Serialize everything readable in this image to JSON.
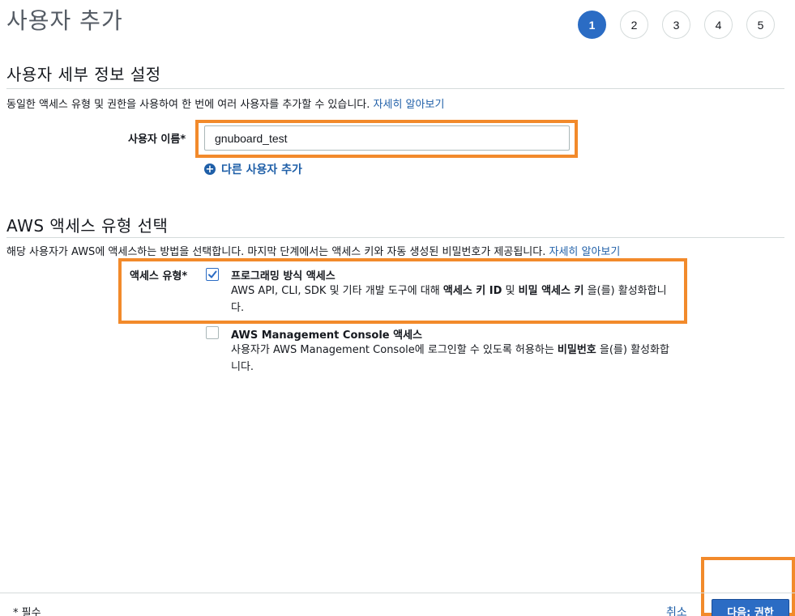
{
  "page": {
    "title": "사용자 추가"
  },
  "steps": [
    "1",
    "2",
    "3",
    "4",
    "5"
  ],
  "user_details": {
    "heading": "사용자 세부 정보 설정",
    "description": "동일한 액세스 유형 및 권한을 사용하여 한 번에 여러 사용자를 추가할 수 있습니다.",
    "learn_more": "자세히 알아보기",
    "username_label": "사용자 이름*",
    "username_value": "gnuboard_test",
    "add_user_label": "다른 사용자 추가"
  },
  "access_type": {
    "heading": "AWS 액세스 유형 선택",
    "description": "해당 사용자가 AWS에 액세스하는 방법을 선택합니다. 마지막 단계에서는 액세스 키와 자동 생성된 비밀번호가 제공됩니다.",
    "learn_more": "자세히 알아보기",
    "label": "액세스 유형*",
    "options": [
      {
        "title": "프로그래밍 방식 액세스",
        "desc_1": "AWS API, CLI, SDK 및 기타 개발 도구에 대해 ",
        "bold_1": "액세스 키 ID",
        "desc_2": " 및 ",
        "bold_2": "비밀 액세스 키",
        "desc_3": " 을(를) 활성화합니다.",
        "checked": true
      },
      {
        "title": "AWS Management Console 액세스",
        "desc_1": "사용자가 AWS Management Console에 로그인할 수 있도록 허용하는 ",
        "bold_1": "비밀번호",
        "desc_2": " 을(를) 활성화합니다.",
        "checked": false
      }
    ]
  },
  "footer": {
    "required_note": "* 필수",
    "cancel_label": "취소",
    "next_label": "다음: 권한"
  },
  "colors": {
    "accent": "#2b6cc4",
    "link": "#1f5fa8",
    "highlight": "#f28a2b"
  }
}
